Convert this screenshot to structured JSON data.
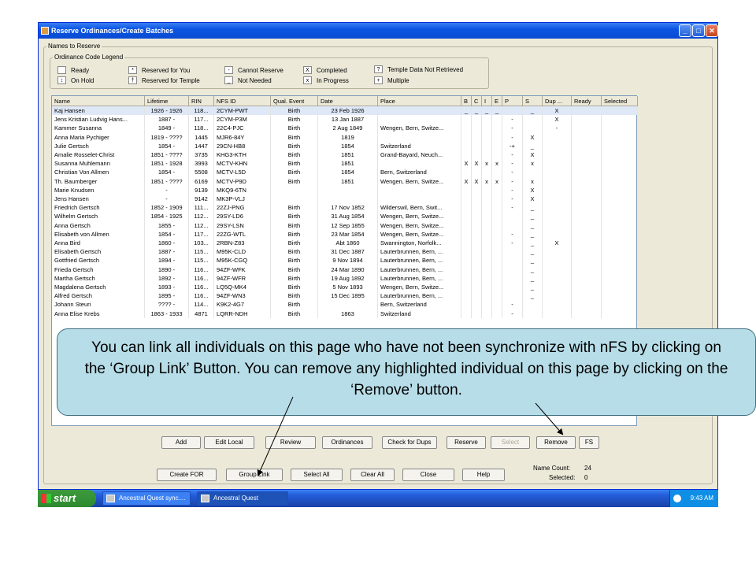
{
  "window": {
    "title": "Reserve Ordinances/Create Batches",
    "min_icon": "minimize-icon",
    "max_icon": "maximize-icon",
    "close_icon": "close-icon"
  },
  "group_label": "Names to Reserve",
  "legend": {
    "label": "Ordinance Code Legend",
    "items": [
      {
        "symbol": "",
        "text": "Ready"
      },
      {
        "symbol": "↕",
        "text": "On Hold"
      },
      {
        "symbol": "*",
        "text": "Reserved for You"
      },
      {
        "symbol": "†",
        "text": "Reserved for Temple"
      },
      {
        "symbol": "-",
        "text": "Cannot Reserve"
      },
      {
        "symbol": "_",
        "text": "Not Needed"
      },
      {
        "symbol": "X",
        "text": "Completed"
      },
      {
        "symbol": "x",
        "text": "In Progress"
      },
      {
        "symbol": "?",
        "text": "Temple Data Not Retrieved"
      },
      {
        "symbol": "+",
        "text": "Multiple"
      }
    ]
  },
  "columns": [
    "Name",
    "Lifetime",
    "RIN",
    "NFS ID",
    "Qual. Event",
    "Date",
    "Place",
    "B",
    "C",
    "I",
    "E",
    "P",
    "S",
    "Dup ...",
    "Ready",
    "Selected"
  ],
  "rows": [
    [
      "Kaj Hansen",
      "1926 - 1926",
      "118...",
      "2CYM-PWT",
      "Birth",
      "23 Feb 1926",
      "",
      "_",
      "_",
      "_",
      "_",
      "",
      "_",
      "X",
      "",
      ""
    ],
    [
      "Jens Kristian Ludvig Hans...",
      "1887 -",
      "117...",
      "2CYM-P3M",
      "Birth",
      "13 Jan 1887",
      "",
      "",
      "",
      "",
      "",
      "-",
      "",
      "X",
      "",
      ""
    ],
    [
      "Kammer Susanna",
      "1849 -",
      "118...",
      "22C4-PJC",
      "Birth",
      "2 Aug 1849",
      "Wengen, Bern, Switze...",
      "",
      "",
      "",
      "",
      "-",
      "",
      "-",
      "",
      ""
    ],
    [
      "Anna Maria Pychiger",
      "1819 - ????",
      "1445",
      "MJR6-84Y",
      "Birth",
      "1819",
      "",
      "",
      "",
      "",
      "",
      "-",
      "X",
      "",
      "",
      ""
    ],
    [
      "Julie Gertsch",
      "1854 -",
      "1447",
      "29CN-HB8",
      "Birth",
      "1854",
      "Switzerland",
      "",
      "",
      "",
      "",
      "-+",
      "_",
      "",
      "",
      ""
    ],
    [
      "Amalie Rosselet-Christ",
      "1851 - ????",
      "3735",
      "KHG3-KTH",
      "Birth",
      "1851",
      "Grand-Bayard, Neuch...",
      "",
      "",
      "",
      "",
      "-",
      "X",
      "",
      "",
      ""
    ],
    [
      "Susanna Muhlemann",
      "1851 - 1928",
      "3993",
      "MCTV-KHN",
      "Birth",
      "1851",
      "",
      "X",
      "X",
      "x",
      "x",
      "-",
      "x",
      "",
      "",
      ""
    ],
    [
      "Christian Von Allmen",
      "1854 -",
      "5508",
      "MCTV-L5D",
      "Birth",
      "1854",
      "Bern, Switzerland",
      "",
      "",
      "",
      "",
      "-",
      "",
      "",
      "",
      ""
    ],
    [
      "Th. Baumberger",
      "1851 - ????",
      "6169",
      "MCTV-P9D",
      "Birth",
      "1851",
      "Wengen, Bern, Switze...",
      "X",
      "X",
      "x",
      "x",
      "-",
      "x",
      "",
      "",
      ""
    ],
    [
      "Marie Knudsen",
      "-",
      "9139",
      "MKQ9-6TN",
      "",
      "",
      "",
      "",
      "",
      "",
      "",
      "-",
      "X",
      "",
      "",
      ""
    ],
    [
      "Jens Hansen",
      "-",
      "9142",
      "MK3P-VLJ",
      "",
      "",
      "",
      "",
      "",
      "",
      "",
      "-",
      "X",
      "",
      "",
      ""
    ],
    [
      "Friedrich Gertsch",
      "1852 - 1909",
      "111...",
      "22ZJ-PNG",
      "Birth",
      "17 Nov 1852",
      "Wilderswil, Bern, Swit...",
      "",
      "",
      "",
      "",
      "-",
      "_",
      "",
      "",
      ""
    ],
    [
      "Wilhelm Gertsch",
      "1854 - 1925",
      "112...",
      "29SY-LD6",
      "Birth",
      "31 Aug 1854",
      "Wengen, Bern, Switze...",
      "",
      "",
      "",
      "",
      "",
      "_",
      "",
      "",
      ""
    ],
    [
      "Anna Gertsch",
      "1855 -",
      "112...",
      "29SY-LSN",
      "Birth",
      "12 Sep 1855",
      "Wengen, Bern, Switze...",
      "",
      "",
      "",
      "",
      "",
      "_",
      "",
      "",
      ""
    ],
    [
      "Elisabeth von Allmen",
      "1854 -",
      "117...",
      "22ZG-WTL",
      "Birth",
      "23 Mar 1854",
      "Wengen, Bern, Switze...",
      "",
      "",
      "",
      "",
      "-",
      "_",
      "",
      "",
      ""
    ],
    [
      "Anna Bird",
      "1860 -",
      "103...",
      "2RBN-Z83",
      "Birth",
      "Abt 1860",
      "Swannington, Norfolk...",
      "",
      "",
      "",
      "",
      "-",
      "_",
      "X",
      "",
      ""
    ],
    [
      "Elisabeth Gertsch",
      "1887 -",
      "115...",
      "M95K-CLD",
      "Birth",
      "31 Dec 1887",
      "Lauterbrunnen, Bern, ...",
      "",
      "",
      "",
      "",
      "",
      "_",
      "",
      "",
      ""
    ],
    [
      "Gottfried Gertsch",
      "1894 -",
      "115...",
      "M95K-CGQ",
      "Birth",
      "9 Nov 1894",
      "Lauterbrunnen, Bern, ...",
      "",
      "",
      "",
      "",
      "",
      "_",
      "",
      "",
      ""
    ],
    [
      "Frieda Gertsch",
      "1890 -",
      "116...",
      "94ZF-WFK",
      "Birth",
      "24 Mar 1890",
      "Lauterbrunnen, Bern, ...",
      "",
      "",
      "",
      "",
      "",
      "_",
      "",
      "",
      ""
    ],
    [
      "Martha Gertsch",
      "1892 -",
      "116...",
      "94ZF-WFR",
      "Birth",
      "19 Aug 1892",
      "Lauterbrunnen, Bern, ...",
      "",
      "",
      "",
      "",
      "",
      "_",
      "",
      "",
      ""
    ],
    [
      "Magdalena Gertsch",
      "1893 -",
      "116...",
      "LQ5Q-MK4",
      "Birth",
      "5 Nov 1893",
      "Wengen, Bern, Switze...",
      "",
      "",
      "",
      "",
      "",
      "_",
      "",
      "",
      ""
    ],
    [
      "Alfred Gertsch",
      "1895 -",
      "116...",
      "94ZF-WN3",
      "Birth",
      "15 Dec 1895",
      "Lauterbrunnen, Bern, ...",
      "",
      "",
      "",
      "",
      "",
      "_",
      "",
      "",
      ""
    ],
    [
      "Johann Steuri",
      "???? -",
      "114...",
      "K9K2-4G7",
      "Birth",
      "",
      "Bern, Switzerland",
      "",
      "",
      "",
      "",
      "-",
      "",
      "",
      "",
      ""
    ],
    [
      "Anna Elise Krebs",
      "1863 - 1933",
      "4871",
      "LQRR-NDH",
      "Birth",
      "1863",
      "Switzerland",
      "",
      "",
      "",
      "",
      "-",
      "",
      "",
      "",
      ""
    ]
  ],
  "buttons_row1": [
    {
      "label": "Add",
      "enabled": true
    },
    {
      "label": "Edit Local",
      "enabled": true
    },
    {
      "label": "Review",
      "enabled": true
    },
    {
      "label": "Ordinances",
      "enabled": true
    },
    {
      "label": "Check for Dups",
      "enabled": true
    },
    {
      "label": "Reserve",
      "enabled": true
    },
    {
      "label": "Select",
      "enabled": false
    },
    {
      "label": "Remove",
      "enabled": true
    },
    {
      "label": "FS",
      "enabled": true
    }
  ],
  "buttons_row2": [
    {
      "label": "Create FOR"
    },
    {
      "label": "Group Link"
    },
    {
      "label": "Select All"
    },
    {
      "label": "Clear All"
    },
    {
      "label": "Close"
    },
    {
      "label": "Help"
    }
  ],
  "counts": {
    "name_count_label": "Name Count:",
    "name_count_value": "24",
    "selected_label": "Selected:",
    "selected_value": "0"
  },
  "taskbar": {
    "start_label": "start",
    "tasks": [
      "Ancestral Quest sync....",
      "Ancestral Quest"
    ],
    "clock": "9:43 AM"
  },
  "callout": {
    "text": "You can link all individuals on this page who have not been synchronize with nFS by clicking on the ‘Group Link’ Button.  You can remove any highlighted individual on this page by clicking on the ‘Remove’ button."
  }
}
